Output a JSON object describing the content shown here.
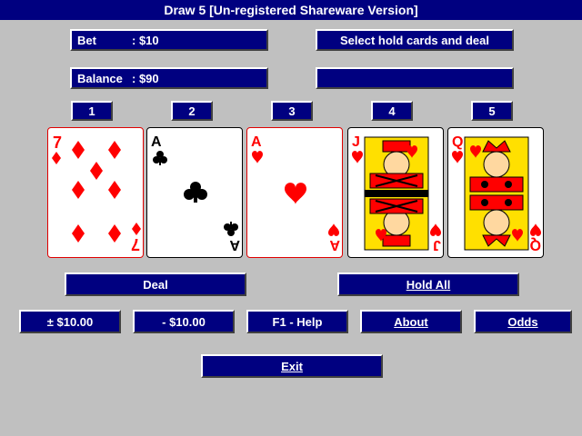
{
  "window": {
    "title": "Draw 5 [Un-registered Shareware Version]"
  },
  "info": {
    "bet_label": "Bet",
    "bet_value": ": $10",
    "balance_label": "Balance",
    "balance_value": ": $90",
    "message": "Select hold cards and deal",
    "message2": ""
  },
  "hold_buttons": [
    "1",
    "2",
    "3",
    "4",
    "5"
  ],
  "cards": [
    {
      "rank": "7",
      "suit": "diamonds",
      "color": "#ff0000"
    },
    {
      "rank": "A",
      "suit": "clubs",
      "color": "#000000"
    },
    {
      "rank": "A",
      "suit": "hearts",
      "color": "#ff0000"
    },
    {
      "rank": "J",
      "suit": "hearts",
      "color": "#ff0000"
    },
    {
      "rank": "Q",
      "suit": "hearts",
      "color": "#ff0000"
    }
  ],
  "buttons": {
    "deal": "Deal",
    "hold_all": "Hold All",
    "plus10": "± $10.00",
    "minus10": "- $10.00",
    "help": "F1 - Help",
    "about": "About",
    "odds": "Odds",
    "exit": "Exit"
  },
  "colors": {
    "panel": "#000080",
    "background": "#c0c0c0",
    "red": "#ff0000"
  }
}
